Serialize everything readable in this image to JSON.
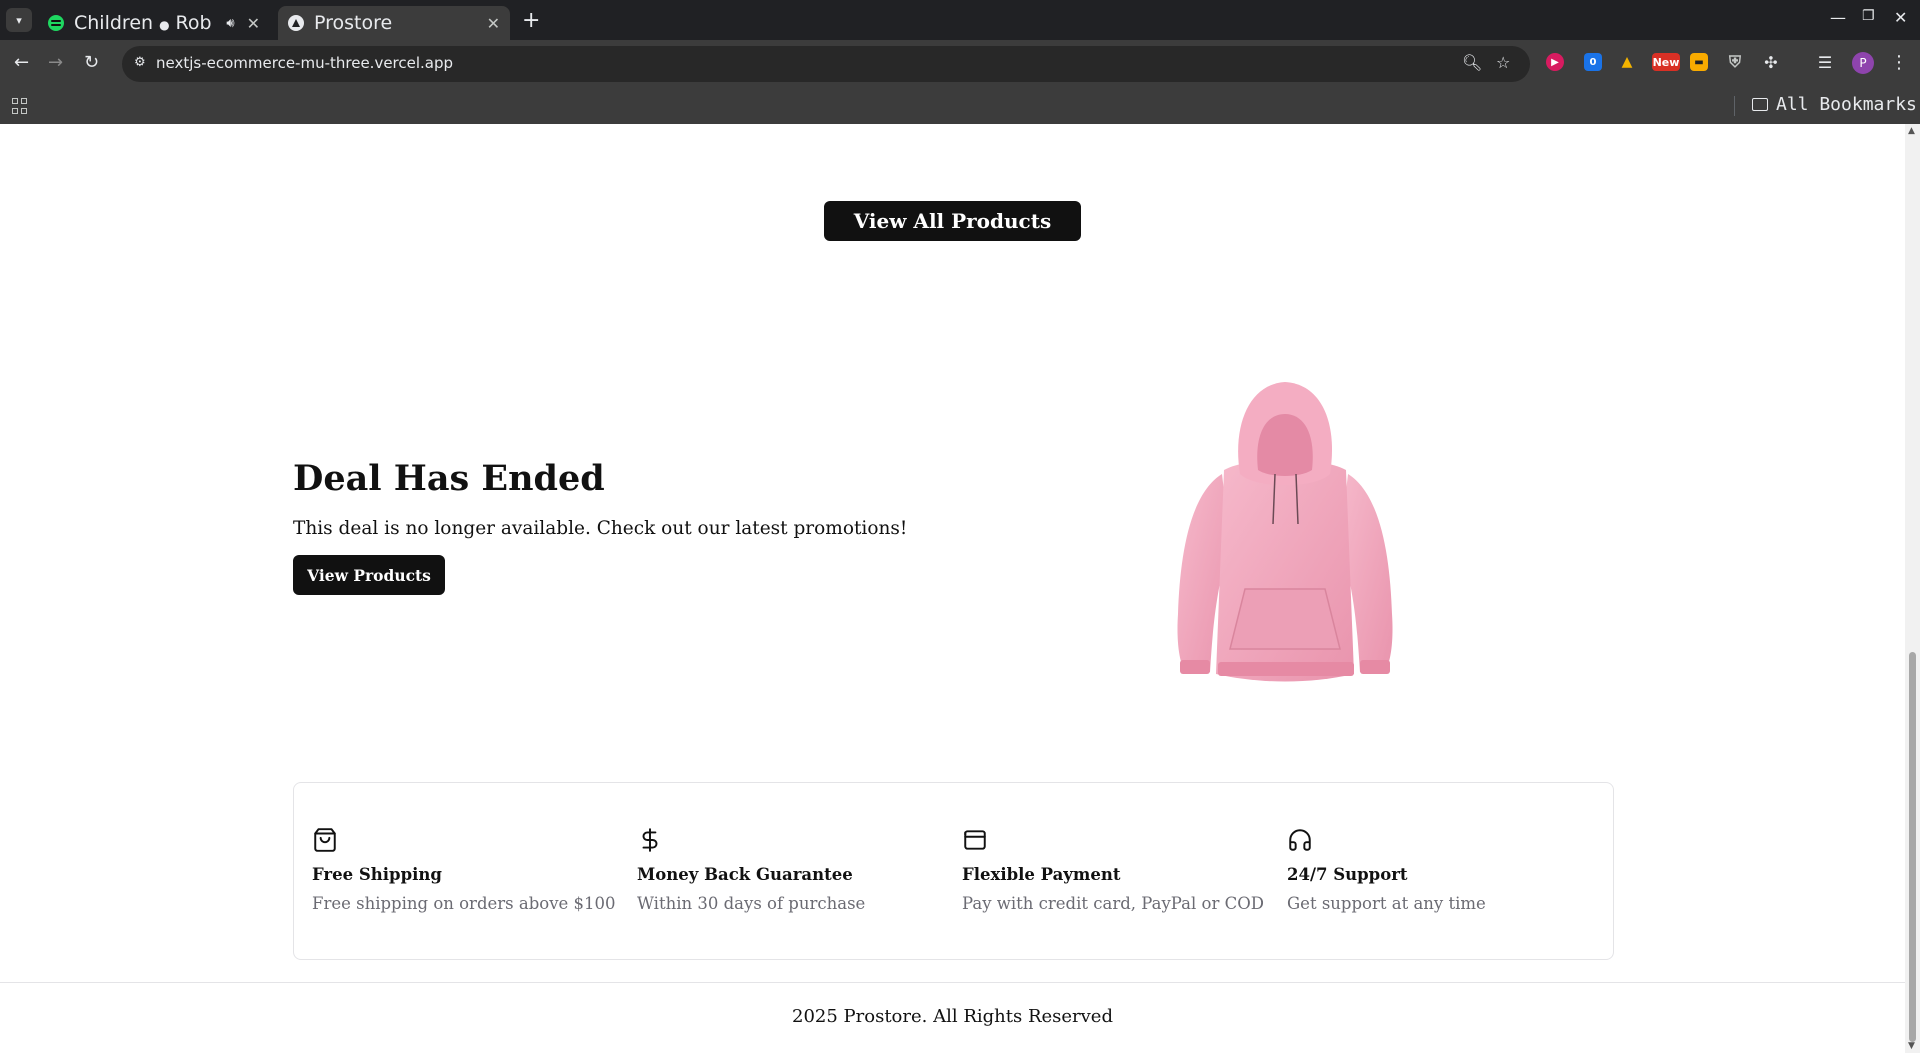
{
  "browser": {
    "tabs": [
      {
        "title": "Children",
        "subtitle": "Rob",
        "audio": true,
        "active": false
      },
      {
        "title": "Prostore",
        "active": true
      }
    ],
    "url": "nextjs-ecommerce-mu-three.vercel.app",
    "bookmarks_label": "All Bookmarks",
    "extension_badge": "New",
    "extension_counter": "0",
    "profile_initial": "P"
  },
  "page": {
    "view_all_label": "View All Products",
    "deal": {
      "title": "Deal Has Ended",
      "text": "This deal is no longer available. Check out our latest promotions!",
      "button_label": "View Products",
      "image_color": "#f2a7bc"
    },
    "features": [
      {
        "icon": "shopping-bag-icon",
        "title": "Free Shipping",
        "desc": "Free shipping on orders above $100"
      },
      {
        "icon": "dollar-sign-icon",
        "title": "Money Back Guarantee",
        "desc": "Within 30 days of purchase"
      },
      {
        "icon": "wallet-icon",
        "title": "Flexible Payment",
        "desc": "Pay with credit card, PayPal or COD"
      },
      {
        "icon": "headset-icon",
        "title": "24/7 Support",
        "desc": "Get support at any time"
      }
    ],
    "footer": "2025 Prostore. All Rights Reserved"
  }
}
